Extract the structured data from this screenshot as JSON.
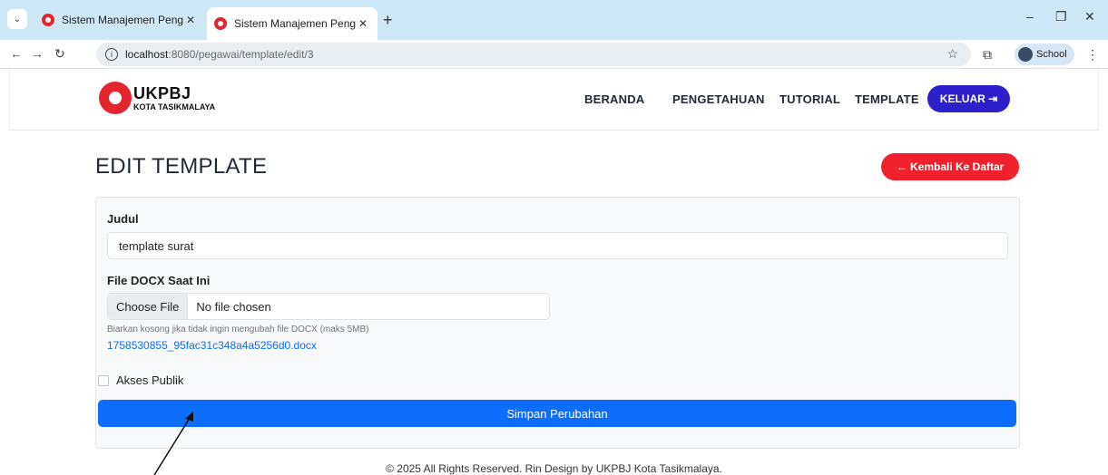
{
  "browser": {
    "tabs": [
      {
        "title": "Sistem Manajemen Pengetahuan",
        "active": false
      },
      {
        "title": "Sistem Manajemen Pengetahuan",
        "active": true
      }
    ],
    "url_host": "localhost",
    "url_path": ":8080/pegawai/template/edit/3",
    "profile_label": "School"
  },
  "header": {
    "logo_title": "UKPBJ",
    "logo_subtitle": "KOTA TASIKMALAYA",
    "nav": [
      {
        "label": "BERANDA"
      },
      {
        "label": "PENGETAHUAN"
      },
      {
        "label": "TUTORIAL"
      },
      {
        "label": "TEMPLATE"
      }
    ],
    "logout_label": "KELUAR ⇥"
  },
  "page": {
    "title": "EDIT TEMPLATE",
    "back_label": "← Kembali Ke Daftar"
  },
  "form": {
    "judul_label": "Judul",
    "judul_value": "template surat",
    "file_label": "File DOCX Saat Ini",
    "choose_file_label": "Choose File",
    "no_file_label": "No file chosen",
    "hint": "Biarkan kosong jika tidak ingin mengubah file DOCX (maks 5MB)",
    "current_file": "1758530855_95fac31c348a4a5256d0.docx",
    "public_label": "Akses Publik",
    "public_checked": false,
    "save_label": "Simpan Perubahan"
  },
  "footer": {
    "text": "© 2025 All Rights Reserved. Rin Design by UKPBJ Kota Tasikmalaya."
  },
  "colors": {
    "primary": "#0d6efd",
    "logout": "#2d1fc9",
    "back": "#f0202d",
    "brand_red": "#e3262e"
  }
}
